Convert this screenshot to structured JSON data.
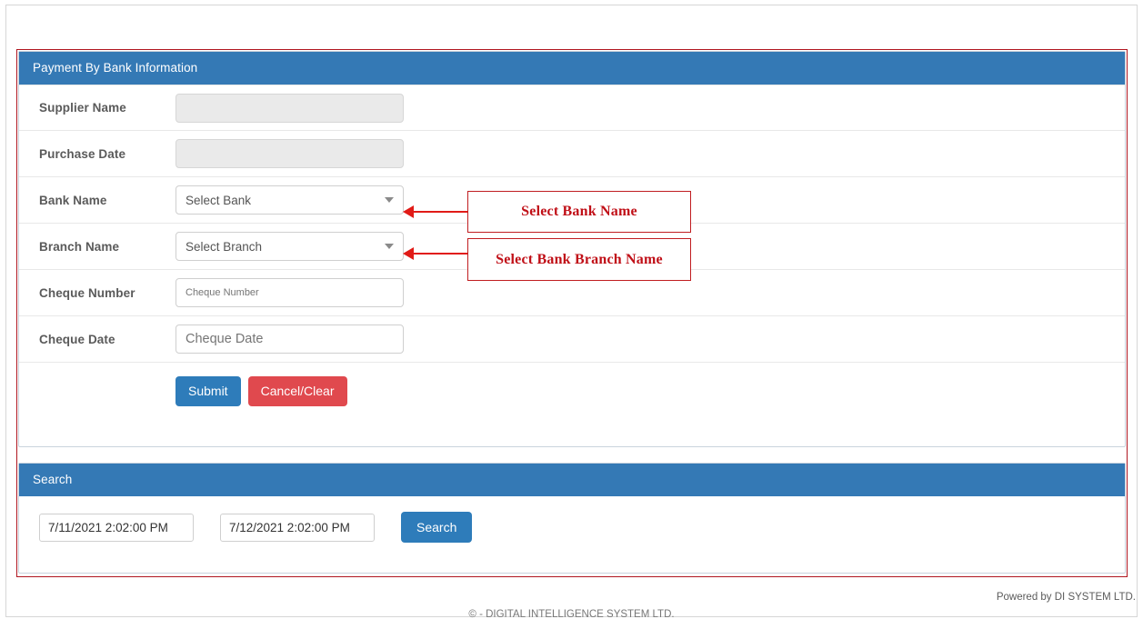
{
  "panels": {
    "main": {
      "title": "Payment By Bank Information"
    },
    "search": {
      "title": "Search"
    }
  },
  "form": {
    "rows": [
      {
        "label": "Supplier Name",
        "value": "",
        "placeholder": "",
        "type": "readonly"
      },
      {
        "label": "Purchase Date",
        "value": "",
        "placeholder": "",
        "type": "readonly"
      },
      {
        "label": "Bank Name",
        "value": "Select Bank",
        "placeholder": "",
        "type": "select"
      },
      {
        "label": "Branch Name",
        "value": "Select Branch",
        "placeholder": "",
        "type": "select"
      },
      {
        "label": "Cheque Number",
        "value": "",
        "placeholder": "Cheque Number",
        "type": "text-small"
      },
      {
        "label": "Cheque Date",
        "value": "",
        "placeholder": "Cheque Date",
        "type": "text-big"
      }
    ],
    "buttons": {
      "submit": "Submit",
      "cancel": "Cancel/Clear"
    }
  },
  "search": {
    "date_from": "7/11/2021 2:02:00 PM",
    "date_to": "7/12/2021 2:02:00 PM",
    "button": "Search"
  },
  "annotations": [
    {
      "text": "Select Bank Name",
      "icon": "left-arrow-icon"
    },
    {
      "text": "Select Bank Branch Name",
      "icon": "left-arrow-icon"
    }
  ],
  "footer": {
    "powered_by": "Powered by DI SYSTEM LTD.",
    "copyright": "©  - DIGITAL INTELLIGENCE SYSTEM LTD."
  },
  "colors": {
    "panel_header_blue": "#3479b5",
    "submit_blue": "#2e7cba",
    "cancel_red": "#e0494e",
    "annotation_red": "#c00f17",
    "outline_red": "#b01620"
  }
}
